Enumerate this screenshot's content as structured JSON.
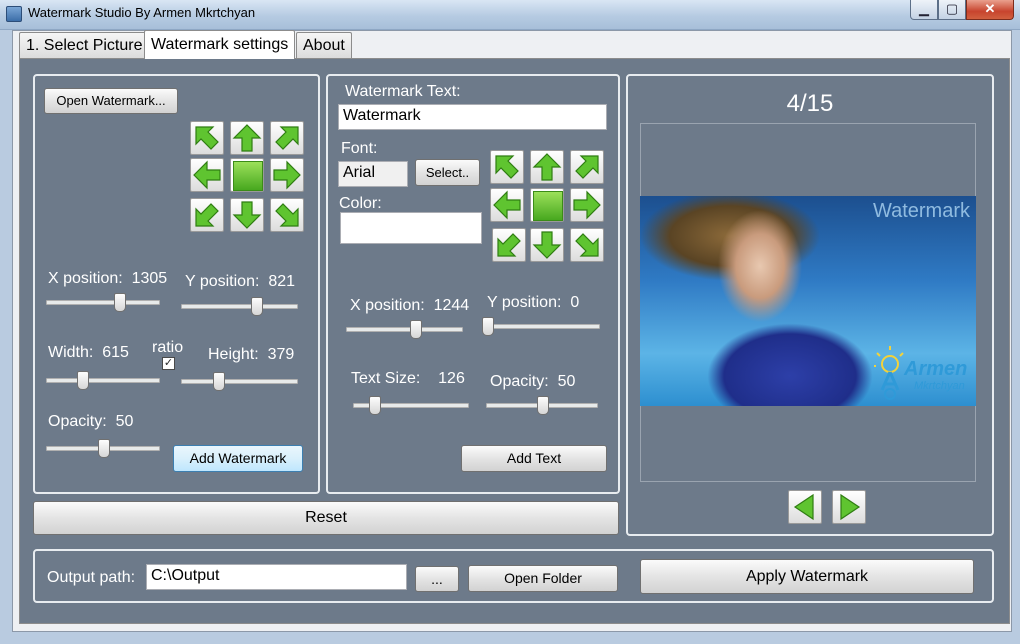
{
  "window": {
    "title": "Watermark Studio By Armen Mkrtchyan",
    "minimize": "▁",
    "maximize": "▢",
    "close": "✕"
  },
  "tabs": [
    {
      "label": "1. Select Picture"
    },
    {
      "label": "Watermark settings"
    },
    {
      "label": "About"
    }
  ],
  "image_panel": {
    "open_button": "Open Watermark...",
    "x_label": "X position:",
    "x_value": "1305",
    "x_slider_fraction": 0.65,
    "y_label": "Y position:",
    "y_value": "821",
    "y_slider_fraction": 0.65,
    "width_label": "Width:",
    "width_value": "615",
    "width_slider_fraction": 0.3,
    "ratio_label": "ratio",
    "ratio_checked": true,
    "height_label": "Height:",
    "height_value": "379",
    "height_slider_fraction": 0.3,
    "opacity_label": "Opacity:",
    "opacity_value": "50",
    "opacity_slider_fraction": 0.5,
    "add_button": "Add Watermark"
  },
  "text_panel": {
    "text_label": "Watermark Text:",
    "text_value": "Watermark",
    "font_label": "Font:",
    "font_value": "Arial",
    "select_button": "Select..",
    "color_label": "Color:",
    "color_value": "#ffffff",
    "x_label": "X position:",
    "x_value": "1244",
    "x_slider_fraction": 0.6,
    "y_label": "Y position:",
    "y_value": "0",
    "y_slider_fraction": 0.0,
    "size_label": "Text Size:",
    "size_value": "126",
    "size_slider_fraction": 0.15,
    "opacity_label": "Opacity:",
    "opacity_value": "50",
    "opacity_slider_fraction": 0.5,
    "add_button": "Add Text"
  },
  "reset_button": "Reset",
  "preview": {
    "counter": "4/15",
    "watermark_text": "Watermark",
    "logo_text_1": "Armen",
    "logo_text_2": "Mkrtchyan"
  },
  "output": {
    "label": "Output path:",
    "path": "C:\\Output",
    "browse_button": "...",
    "open_folder_button": "Open Folder",
    "apply_button": "Apply  Watermark"
  },
  "colors": {
    "panel": "#6d7a8a",
    "accent_green": "#47a81f"
  }
}
